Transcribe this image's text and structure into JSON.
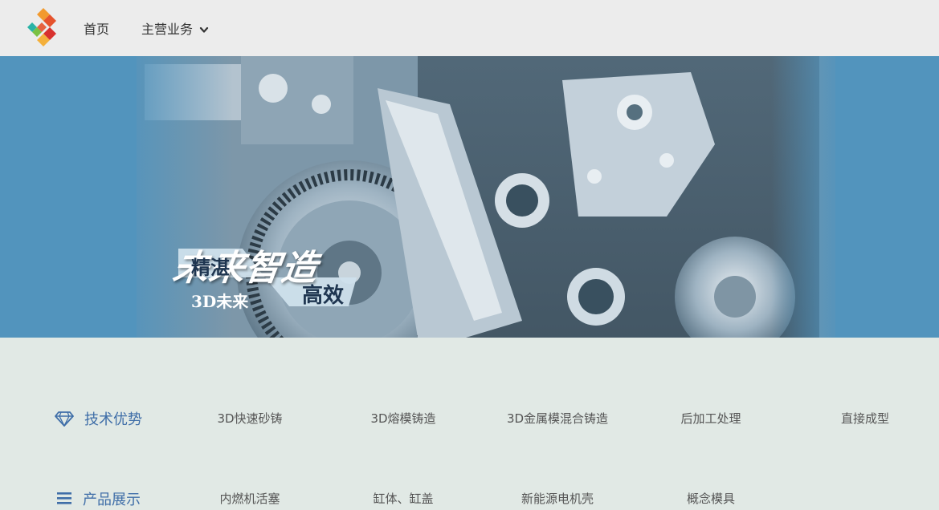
{
  "nav": {
    "logo_icon": "three-color-logo-icon",
    "items": [
      {
        "label": "首页"
      },
      {
        "label": "主营业务",
        "icon": "chevron-down-icon"
      }
    ]
  },
  "banner": {
    "slogan": "未来智造",
    "tags": [
      "精湛",
      "高效",
      "3D未来"
    ],
    "background_color": "#5294bd"
  },
  "sections": [
    {
      "title": "技术优势",
      "icon": "diamond-icon",
      "links": [
        "3D快速砂铸",
        "3D熔模铸造",
        "3D金属模混合铸造",
        "后加工处理",
        "直接成型"
      ]
    },
    {
      "title": "产品展示",
      "icon": "list-icon",
      "links": [
        "内燃机活塞",
        "缸体、缸盖",
        "新能源电机壳",
        "概念模具"
      ]
    }
  ],
  "colors": {
    "header_bg": "#ececec",
    "page_bg": "#e1e9e5",
    "section_title": "#3f6ea8"
  }
}
